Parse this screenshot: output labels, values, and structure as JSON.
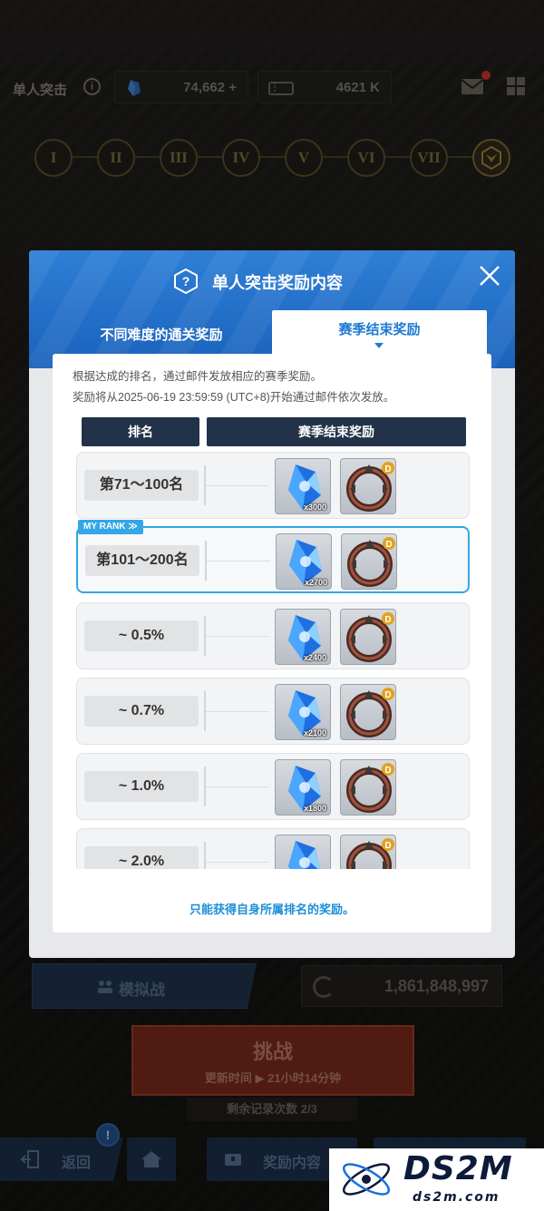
{
  "topbar": {
    "mode_title": "单人突击",
    "info_symbol": "i",
    "currency1": "74,662",
    "currency1_plus": "+",
    "currency2": "4621 K"
  },
  "stages": [
    "I",
    "II",
    "III",
    "IV",
    "V",
    "VI",
    "VII"
  ],
  "modal": {
    "title": "单人突击奖励内容",
    "help_symbol": "?",
    "tabs": {
      "left": "不同难度的通关奖励",
      "right": "赛季结束奖励"
    },
    "desc1": "根据达成的排名，通过邮件发放相应的赛季奖励。",
    "desc2": "奖励将从2025-06-19 23:59:59 (UTC+8)开始通过邮件依次发放。",
    "headers": {
      "rank": "排名",
      "reward": "赛季结束奖励"
    },
    "my_rank_tag": "MY RANK ≫",
    "rows": [
      {
        "rank": "第71～100名",
        "gem_qty": "x3000",
        "is_me": false
      },
      {
        "rank": "第101～200名",
        "gem_qty": "x2700",
        "is_me": true
      },
      {
        "rank": "~ 0.5%",
        "gem_qty": "x2400",
        "is_me": false
      },
      {
        "rank": "~ 0.7%",
        "gem_qty": "x2100",
        "is_me": false
      },
      {
        "rank": "~ 1.0%",
        "gem_qty": "x1800",
        "is_me": false
      },
      {
        "rank": "~ 2.0%",
        "gem_qty": "",
        "is_me": false
      }
    ],
    "ring_badge": "D",
    "footnote": "只能获得自身所属排名的奖励。"
  },
  "background": {
    "simulation_label": "模拟战",
    "power_value": "1,861,848,997",
    "challenge_title": "挑战",
    "challenge_sub": "更新时间 ▶ 21小时14分钟",
    "records": "剩余记录次数 2/3",
    "nav_back": "返回",
    "nav_badge": "!",
    "nav_reward": "奖励内容"
  },
  "watermark": {
    "big": "DS2M",
    "small": "ds2m.com"
  },
  "colors": {
    "accent_blue": "#1f7bd3",
    "header_blue": "#2e7fd6",
    "my_rank_blue": "#35a6e6",
    "table_header": "#223349",
    "challenge_red": "#6b2416"
  }
}
